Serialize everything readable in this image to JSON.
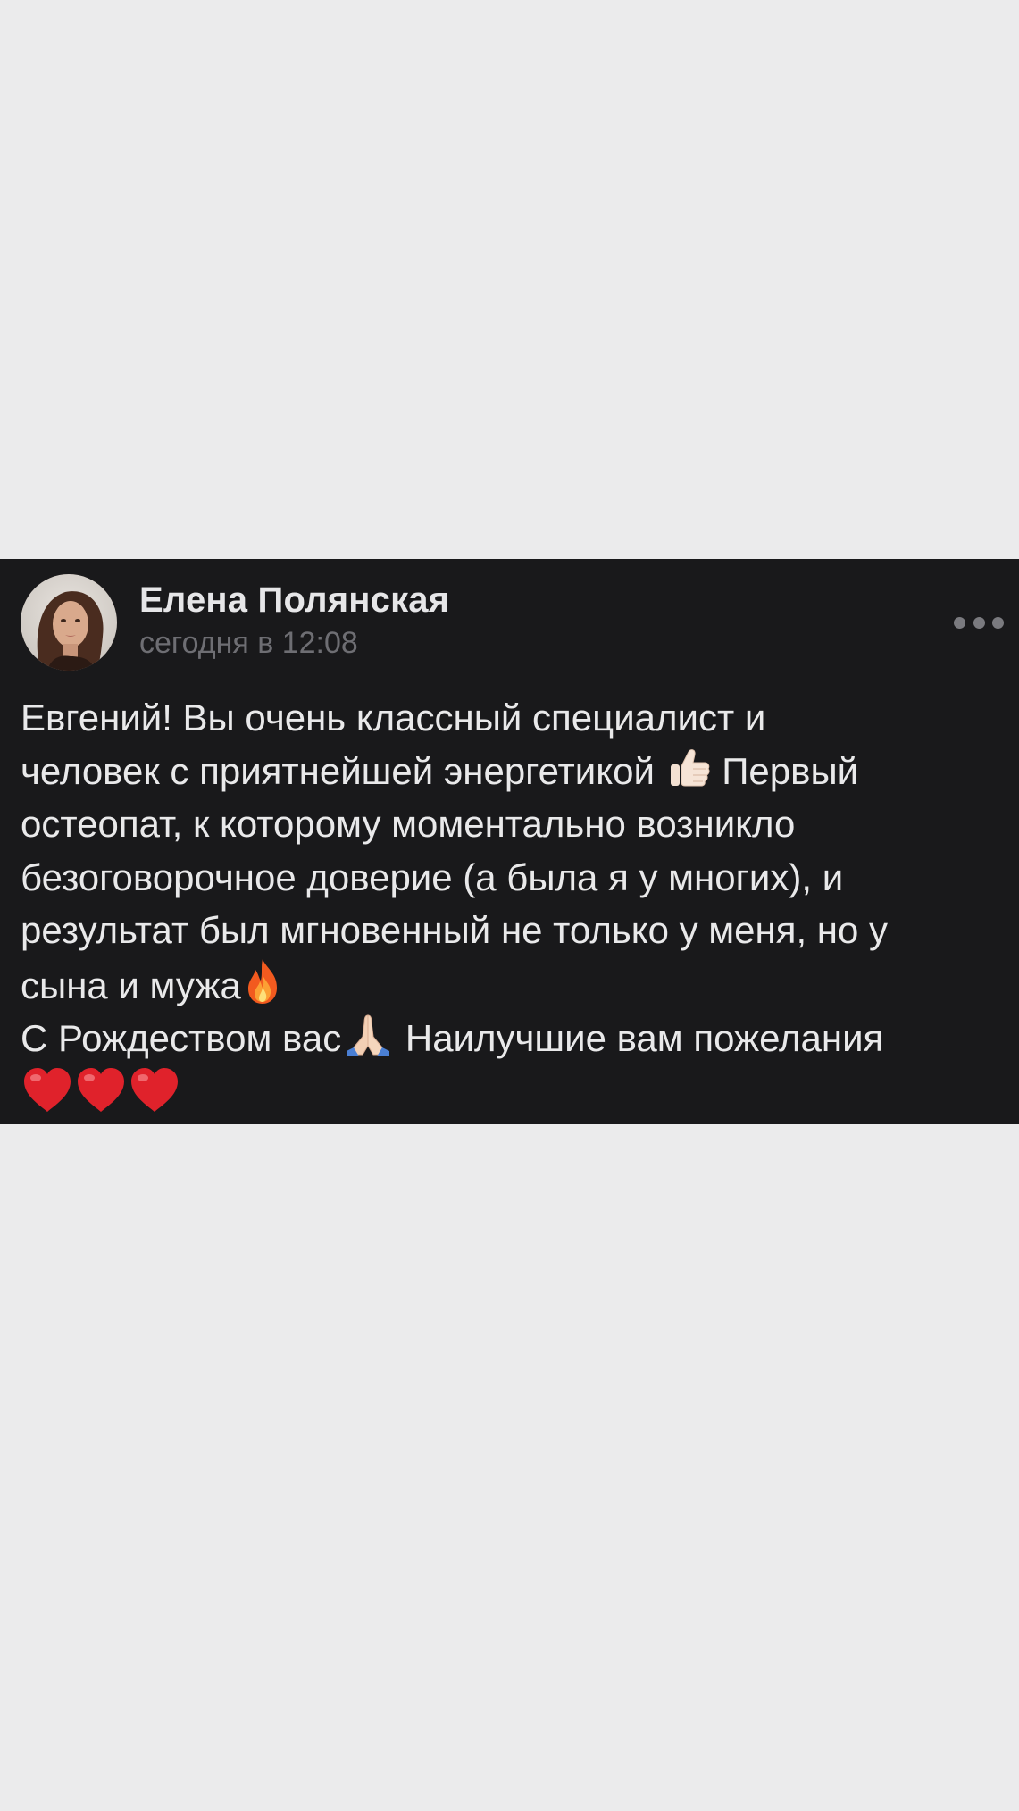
{
  "post": {
    "author_name": "Елена Полянская",
    "timestamp": "сегодня в 12:08",
    "menu_icon": "more-horizontal-icon",
    "text": {
      "seg1": "Евгений! Вы очень классный специалист и\nчеловек с приятнейшей энергетикой ",
      "emoji1": "thumbs-up-icon",
      "seg2": " Первый\nостеопат, к которому моментально возникло\nбезоговорочное доверие (а была я у многих), и\nрезультат был мгновенный не только у меня, но у\nсына и мужа",
      "emoji2": "fire-icon",
      "seg3": "\nС Рождеством вас",
      "emoji3": "praying-hands-icon",
      "seg4": " Наилучшие вам пожелания\n",
      "emoji4": "red-heart-icon"
    }
  },
  "colors": {
    "background": "#EBEBEC",
    "post_background": "#19191B",
    "text": "#E9E9EA",
    "muted": "#6E6E73"
  }
}
